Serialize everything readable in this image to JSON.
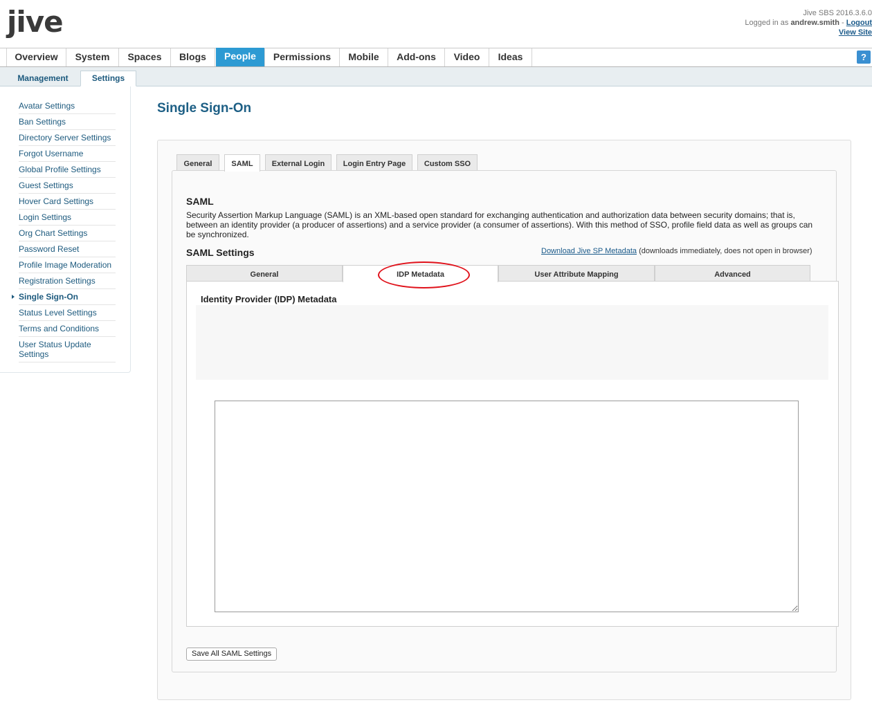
{
  "header": {
    "logo_text": "jive",
    "version": "Jive SBS 2016.3.6.0",
    "logged_in_prefix": "Logged in as",
    "username": "andrew.smith",
    "separator": "-",
    "logout": "Logout",
    "view_site": "View Site"
  },
  "main_nav": {
    "tabs": [
      "Overview",
      "System",
      "Spaces",
      "Blogs",
      "People",
      "Permissions",
      "Mobile",
      "Add-ons",
      "Video",
      "Ideas"
    ],
    "active": "People",
    "help_label": "?"
  },
  "sub_nav": {
    "tabs": [
      "Management",
      "Settings"
    ],
    "active": "Settings"
  },
  "sidebar": {
    "items": [
      "Avatar Settings",
      "Ban Settings",
      "Directory Server Settings",
      "Forgot Username",
      "Global Profile Settings",
      "Guest Settings",
      "Hover Card Settings",
      "Login Settings",
      "Org Chart Settings",
      "Password Reset",
      "Profile Image Moderation",
      "Registration Settings",
      "Single Sign-On",
      "Status Level Settings",
      "Terms and Conditions",
      "User Status Update Settings"
    ],
    "active": "Single Sign-On"
  },
  "page": {
    "title": "Single Sign-On",
    "top_tabs": [
      "General",
      "SAML",
      "External Login",
      "Login Entry Page",
      "Custom SSO"
    ],
    "active_top_tab": "SAML",
    "saml_heading": "SAML",
    "saml_description": "Security Assertion Markup Language (SAML) is an XML-based open standard for exchanging authentication and authorization data between security domains; that is, between an identity provider (a producer of assertions) and a service provider (a consumer of assertions). With this method of SSO, profile field data as well as groups can be synchronized.",
    "saml_settings_heading": "SAML Settings",
    "download_link": "Download Jive SP Metadata",
    "download_note": "(downloads immediately, does not open in browser)",
    "saml_tabs": [
      "General",
      "IDP Metadata",
      "User Attribute Mapping",
      "Advanced"
    ],
    "active_saml_tab": "IDP Metadata",
    "idp_heading": "Identity Provider (IDP) Metadata",
    "idp_metadata_value": "",
    "save_button": "Save All SAML Settings"
  },
  "colors": {
    "active_tab": "#2d9ad3",
    "link": "#1d5a7e",
    "highlight_circle": "#e0121b"
  }
}
